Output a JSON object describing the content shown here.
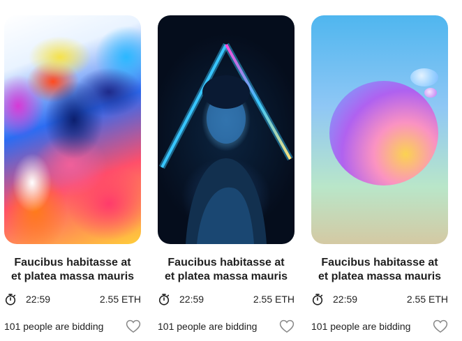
{
  "cards": [
    {
      "title_line1": "Faucibus habitasse at",
      "title_line2": "et platea massa mauris",
      "time": "22:59",
      "price": "2.55 ETH",
      "bidding": "101 people are bidding",
      "icons": {
        "timer": "stopwatch-icon",
        "like": "heart-icon"
      }
    },
    {
      "title_line1": "Faucibus habitasse at",
      "title_line2": "et platea massa mauris",
      "time": "22:59",
      "price": "2.55 ETH",
      "bidding": "101 people are bidding",
      "icons": {
        "timer": "stopwatch-icon",
        "like": "heart-icon"
      }
    },
    {
      "title_line1": "Faucibus habitasse at",
      "title_line2": "et platea massa mauris",
      "time": "22:59",
      "price": "2.55 ETH",
      "bidding": "101 people are bidding",
      "icons": {
        "timer": "stopwatch-icon",
        "like": "heart-icon"
      }
    }
  ],
  "colors": {
    "text": "#1f1f1f",
    "heart_outline": "#888888"
  }
}
